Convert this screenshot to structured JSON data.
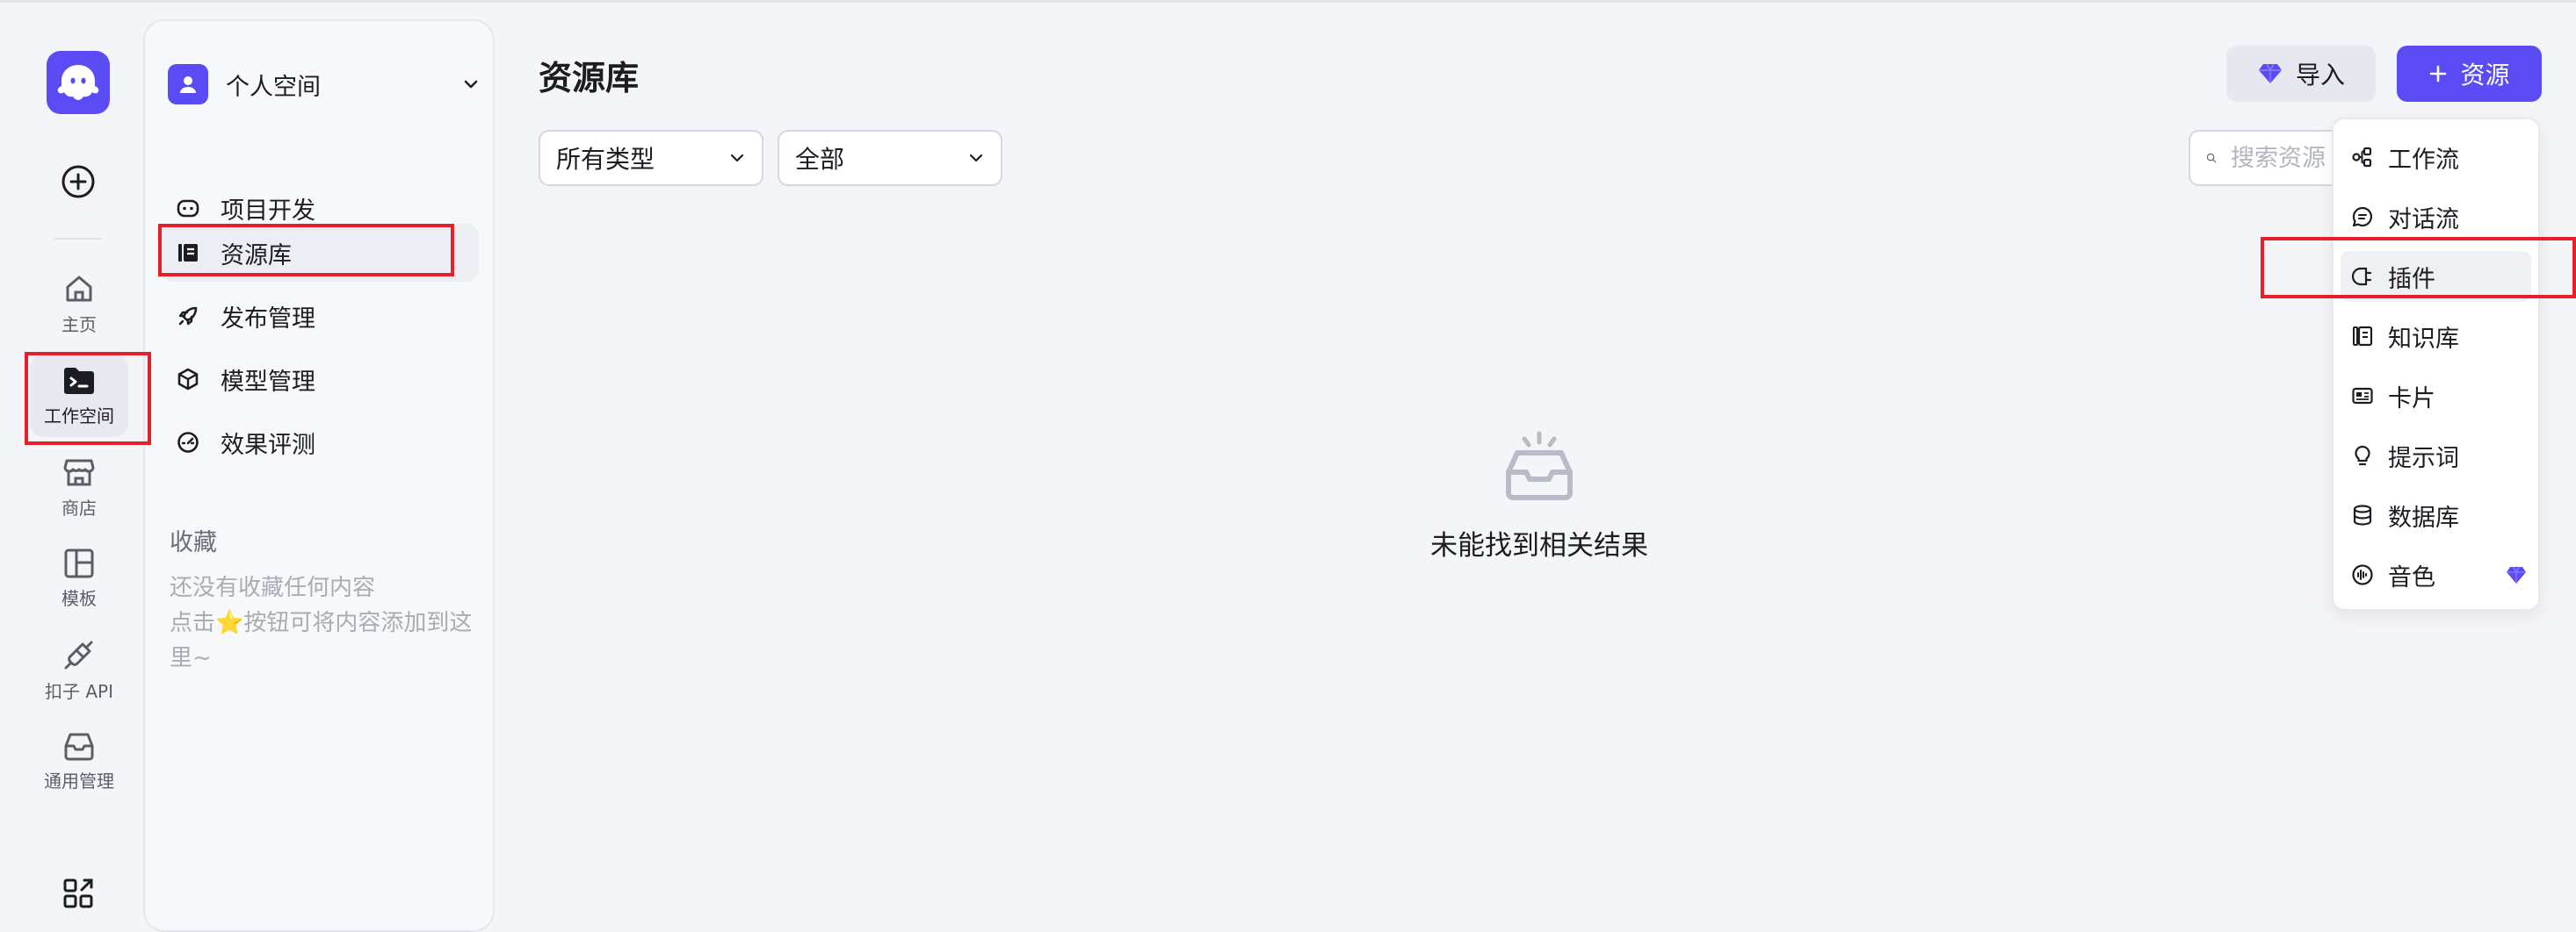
{
  "rail": {
    "items": [
      {
        "label": "主页",
        "icon": "home-icon"
      },
      {
        "label": "工作空间",
        "icon": "terminal-folder-icon"
      },
      {
        "label": "商店",
        "icon": "store-icon"
      },
      {
        "label": "模板",
        "icon": "template-icon"
      },
      {
        "label": "扣子 API",
        "icon": "plug-icon"
      },
      {
        "label": "通用管理",
        "icon": "inbox-icon"
      }
    ],
    "active": "工作空间"
  },
  "sidebar": {
    "space_name": "个人空间",
    "nav": [
      {
        "label": "项目开发",
        "icon": "robot-face-icon"
      },
      {
        "label": "资源库",
        "icon": "library-icon"
      },
      {
        "label": "发布管理",
        "icon": "rocket-icon"
      },
      {
        "label": "模型管理",
        "icon": "model-cube-icon"
      },
      {
        "label": "效果评测",
        "icon": "gauge-icon"
      }
    ],
    "active": "资源库",
    "favorites_title": "收藏",
    "favorites_hint_1": "还没有收藏任何内容",
    "favorites_hint_2a": "点击",
    "favorites_hint_star": "⭐",
    "favorites_hint_2b": "按钮可将内容添加到这里~"
  },
  "main": {
    "title": "资源库",
    "import_label": "导入",
    "add_label": "资源",
    "filter_type": "所有类型",
    "filter_scope": "全部",
    "search_placeholder": "搜索资源",
    "empty_text": "未能找到相关结果"
  },
  "dropdown": {
    "items": [
      {
        "label": "工作流",
        "icon": "workflow-icon"
      },
      {
        "label": "对话流",
        "icon": "chat-flow-icon"
      },
      {
        "label": "插件",
        "icon": "plugin-icon"
      },
      {
        "label": "知识库",
        "icon": "knowledge-icon"
      },
      {
        "label": "卡片",
        "icon": "card-icon"
      },
      {
        "label": "提示词",
        "icon": "bulb-icon"
      },
      {
        "label": "数据库",
        "icon": "database-icon"
      },
      {
        "label": "音色",
        "icon": "voice-icon",
        "premium": true
      }
    ],
    "hovered": "插件"
  },
  "colors": {
    "accent": "#5a4bf5",
    "annotation_red": "#e4202a"
  }
}
